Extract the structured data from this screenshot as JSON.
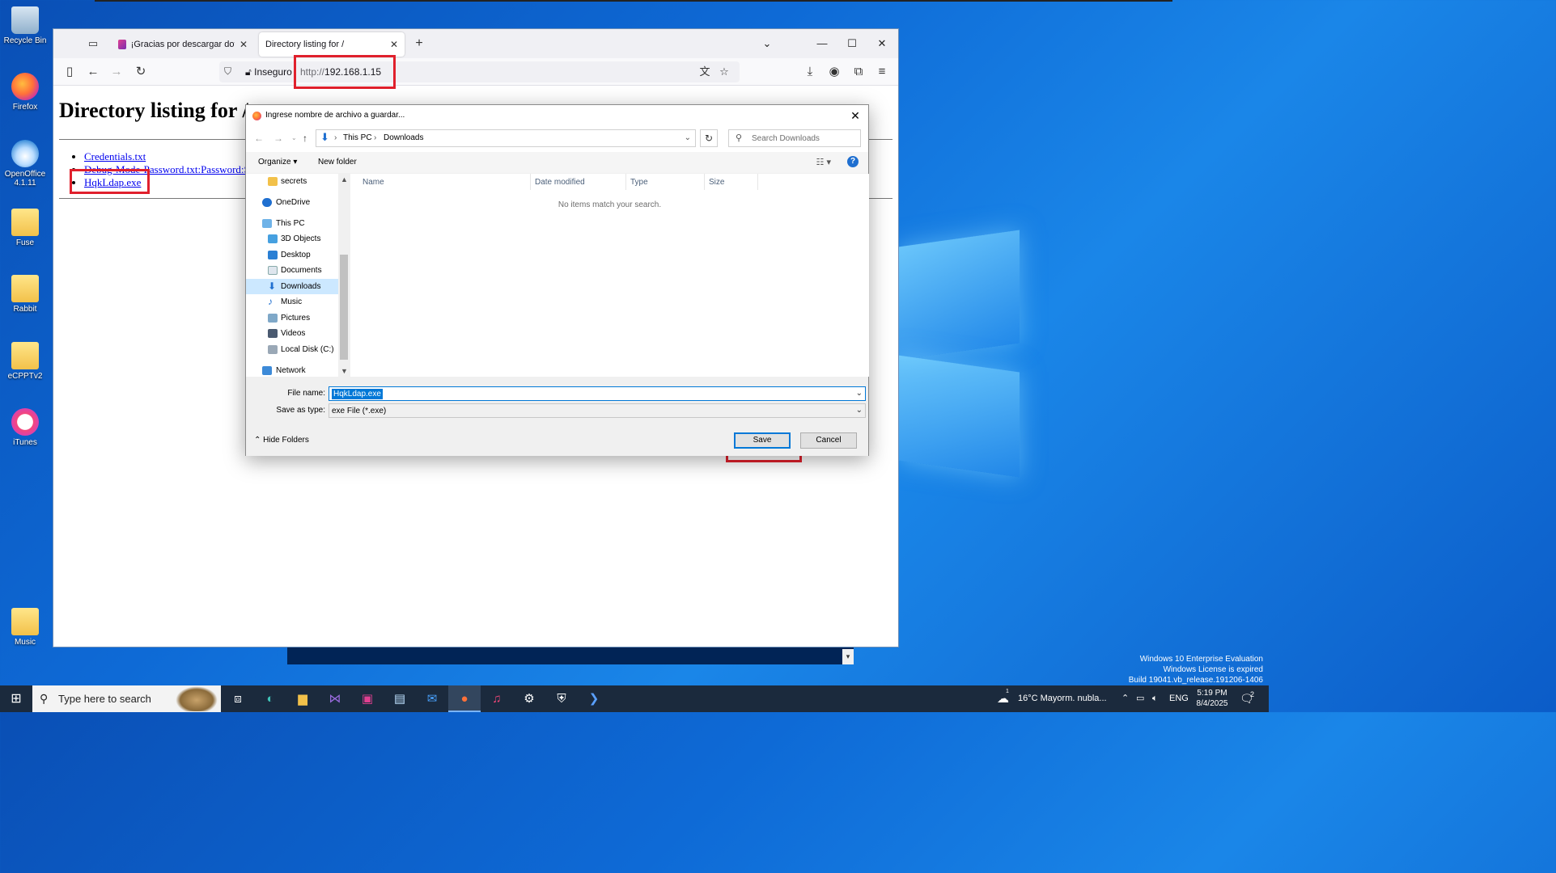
{
  "desktop": {
    "icons": [
      {
        "label": "Recycle Bin",
        "icon": "recycle-bin-icon"
      },
      {
        "label": "Firefox",
        "icon": "firefox-icon"
      },
      {
        "label": "OpenOffice 4.1.11",
        "icon": "openoffice-icon"
      },
      {
        "label": "Fuse",
        "icon": "folder-icon"
      },
      {
        "label": "Rabbit",
        "icon": "folder-icon"
      },
      {
        "label": "eCPPTv2",
        "icon": "folder-icon"
      },
      {
        "label": "iTunes",
        "icon": "itunes-icon"
      },
      {
        "label": "Music",
        "icon": "folder-icon"
      }
    ],
    "watermark": {
      "line1": "Windows 10 Enterprise Evaluation",
      "line2": "Windows License is expired",
      "line3": "Build 19041.vb_release.191206-1406"
    }
  },
  "browser": {
    "tabs": [
      {
        "label": "¡Gracias por descargar dotPeek!",
        "active": false
      },
      {
        "label": "Directory listing for /",
        "active": true
      }
    ],
    "new_tab_symbol": "+",
    "url": {
      "security_label": "Inseguro",
      "protocol": "http://",
      "host": "192.168.1.15"
    },
    "page": {
      "heading": "Directory listing for /",
      "links": [
        "Credentials.txt",
        "Debug-Mode-Password.txt:Password:S",
        "HqkLdap.exe"
      ]
    }
  },
  "dialog": {
    "title": "Ingrese nombre de archivo a guardar...",
    "breadcrumb": [
      "This PC",
      "Downloads"
    ],
    "search_placeholder": "Search Downloads",
    "toolbar": {
      "organize": "Organize",
      "new_folder": "New folder"
    },
    "nav_items": [
      {
        "label": "secrets",
        "icon": "folder-icon"
      },
      {
        "label": "OneDrive",
        "icon": "onedrive-icon"
      },
      {
        "label": "This PC",
        "icon": "computer-icon"
      },
      {
        "label": "3D Objects",
        "icon": "3d-objects-icon"
      },
      {
        "label": "Desktop",
        "icon": "desktop-icon"
      },
      {
        "label": "Documents",
        "icon": "documents-icon"
      },
      {
        "label": "Downloads",
        "icon": "downloads-icon",
        "selected": true
      },
      {
        "label": "Music",
        "icon": "music-icon"
      },
      {
        "label": "Pictures",
        "icon": "pictures-icon"
      },
      {
        "label": "Videos",
        "icon": "videos-icon"
      },
      {
        "label": "Local Disk (C:)",
        "icon": "local-disk-icon"
      },
      {
        "label": "Network",
        "icon": "network-icon"
      }
    ],
    "columns": [
      "Name",
      "Date modified",
      "Type",
      "Size"
    ],
    "empty_message": "No items match your search.",
    "file_name_label": "File name:",
    "file_name_value": "HqkLdap.exe",
    "save_type_label": "Save as type:",
    "save_type_value": "exe File (*.exe)",
    "hide_folders": "Hide Folders",
    "save_label": "Save",
    "cancel_label": "Cancel"
  },
  "taskbar": {
    "search_placeholder": "Type here to search",
    "weather": "16°C  Mayorm. nubla...",
    "language": "ENG",
    "time": "5:19 PM",
    "date": "8/4/2025",
    "notification_count": "2",
    "weather_badge": "1"
  },
  "colors": {
    "highlight_red": "#e0202c",
    "accent_blue": "#0078d7",
    "link": "#0000ee"
  }
}
